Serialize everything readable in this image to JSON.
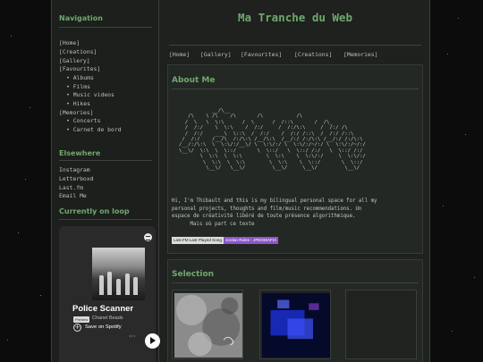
{
  "site": {
    "title": "Ma Tranche du Web"
  },
  "sidebar": {
    "navigation_heading": "Navigation",
    "nav": [
      {
        "label": "[Home]"
      },
      {
        "label": "[Creations]"
      },
      {
        "label": "[Gallery]"
      },
      {
        "label": "[Favourites]"
      },
      {
        "label": "Albums"
      },
      {
        "label": "Films"
      },
      {
        "label": "Music videos"
      },
      {
        "label": "Hikes"
      },
      {
        "label": "[Memories]"
      },
      {
        "label": "Concerts"
      },
      {
        "label": "Carnet de bord"
      }
    ],
    "elsewhere_heading": "Elsewhere",
    "elsewhere": [
      {
        "label": "Instagram"
      },
      {
        "label": "Letterboxd"
      },
      {
        "label": "Last.fm"
      },
      {
        "label": "Email Me"
      }
    ],
    "loop_heading": "Currently on loop"
  },
  "spotify": {
    "track": "Police Scanner",
    "badge": "Preview",
    "artist": "Chanel Beads",
    "save_label": "Save on Spotify",
    "more_label": "···"
  },
  "topnav": [
    {
      "label": "[Home]"
    },
    {
      "label": "[Gallery]"
    },
    {
      "label": "[Favourites]"
    },
    {
      "label": "[Creations]"
    },
    {
      "label": "[Memories]"
    }
  ],
  "about": {
    "heading": "About Me",
    "ascii_art": "           __/\\__                                                \n   /\\    \\ /\\    /\\       /\\           /\\  \n  /  \\   \\  \\:\\      /  \\      /  /::\\       /  /\\_ \n  /  /:/    \\  \\:\\    /  /:/     /  /:/\\:\\     /  /:/ /\\\n  /  /:/    ___\\  \\::\\  /  /:/    /  /:/ /::\\  /  /:/ /::\\\n /  /:/    /__/\\  /:/\\:\\ /__/\\:\\  /__/:/ /:/\\:\\ /__/:/ /:/\\:\\\n/__/:/\\:\\  \\  \\:\\/:/__\\/ \\  \\:\\/:/ \\  \\:\\/:/~/:/ \\  \\:\\/:/~/:/\n\\__\\/  \\:\\  \\  \\::/       \\  \\::/   \\  \\::/ /:/   \\  \\::/ /:/ \n       \\  \\:\\  \\  \\:\\        \\  \\:\\    \\  \\:\\/:/     \\  \\:\\/:/  \n        \\  \\:\\  \\  \\:\\        \\  \\:\\    \\  \\::/       \\  \\::/   \n         \\__\\/   \\__\\/         \\__\\/     \\__\\/         \\__\\/    ",
    "text": "Hi, I'm Thibault and this is my bilingual personal space for all my\npersonal projects, thoughts and film/music recommendations. Un\nespace de créativité libéré de toute présence algorithmique.\n      Mais où part ce texte",
    "lastfm_label": "Last.FM Last Played Song",
    "lastfm_song": "Jordan Rules - JPEGMAFIA"
  },
  "selection": {
    "heading": "Selection"
  },
  "colors": {
    "accent": "#6fa86d",
    "panel": "#242824",
    "lastfm_badge": "#8b57c7"
  }
}
